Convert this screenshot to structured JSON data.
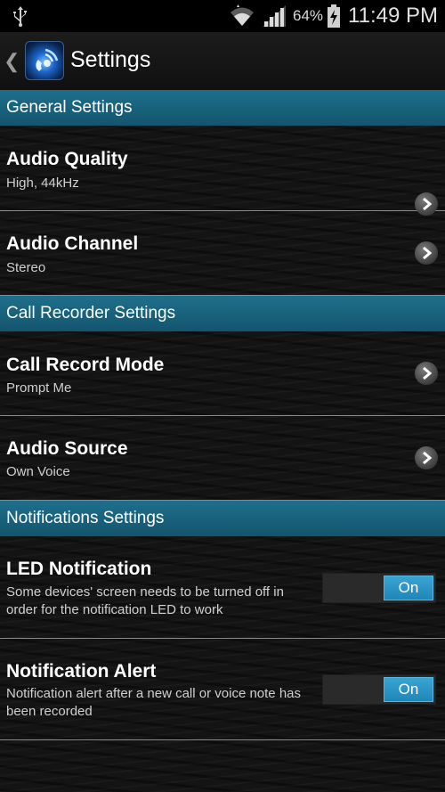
{
  "status_bar": {
    "icons": [
      "usb-icon",
      "wifi-icon",
      "signal-icon",
      "battery-icon"
    ],
    "battery": "64%",
    "time": "11:49 PM"
  },
  "action_bar": {
    "back_icon": "chevron-left-icon",
    "app_icon": "call-recorder-app-icon",
    "title": "Settings"
  },
  "sections": {
    "general": {
      "header": "General Settings",
      "audio_quality": {
        "title": "Audio Quality",
        "summary": "High, 44kHz"
      },
      "audio_channel": {
        "title": "Audio Channel",
        "summary": "Stereo"
      }
    },
    "call_recorder": {
      "header": "Call Recorder Settings",
      "call_record_mode": {
        "title": "Call Record Mode",
        "summary": "Prompt Me"
      },
      "audio_source": {
        "title": "Audio Source",
        "summary": "Own Voice"
      }
    },
    "notifications": {
      "header": "Notifications Settings",
      "led_notification": {
        "title": "LED Notification",
        "summary": "Some devices' screen needs to be turned off in order for the notification LED to work",
        "toggle_label": "On",
        "enabled": true
      },
      "notification_alert": {
        "title": "Notification Alert",
        "summary": "Notification alert after a new call or voice note has been recorded",
        "toggle_label": "On",
        "enabled": true
      }
    }
  },
  "colors": {
    "section_header": "#1a6783",
    "toggle_on": "#2a98cc",
    "background": "#141414"
  }
}
